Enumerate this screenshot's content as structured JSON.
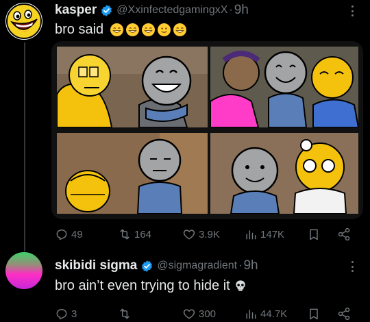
{
  "tweet": {
    "display_name": "kasper",
    "handle": "@XxinfectedgamingxX",
    "separator": "·",
    "time": "9h",
    "text": "bro said",
    "emoji_icons": [
      "grinning-face-icon",
      "grinning-face-icon",
      "grinning-face-icon",
      "smiling-face-icon",
      "grinning-face-icon"
    ],
    "actions": {
      "replies": "49",
      "retweets": "164",
      "likes": "3.9K",
      "views": "147K"
    }
  },
  "reply": {
    "display_name": "skibidi sigma",
    "handle": "@sigmagradient",
    "separator": "·",
    "time": "9h",
    "text": "bro ain’t even trying to hide it",
    "trailing_icon": "skull-icon",
    "actions": {
      "replies": "3",
      "retweets": "",
      "likes": "300",
      "views": "44.7K"
    }
  },
  "colors": {
    "background": "#000000",
    "text": "#e7e9ea",
    "muted": "#71767b",
    "verified": "#1d9bf0",
    "gradient_avatar": [
      "#3fd16a",
      "#ff2ec4",
      "#c52ad8"
    ]
  }
}
